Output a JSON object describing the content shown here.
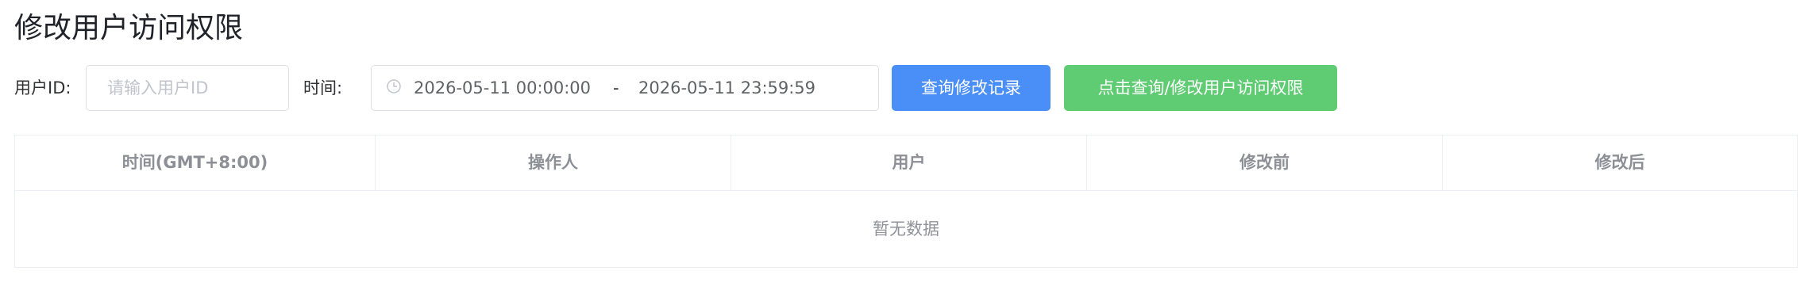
{
  "page_title": "修改用户访问权限",
  "filters": {
    "user_id_label": "用户ID:",
    "user_id_value": "",
    "user_id_placeholder": "请输入用户ID",
    "time_label": "时间:",
    "time_start": "2026-05-11 00:00:00",
    "time_separator": "-",
    "time_end": "2026-05-11 23:59:59"
  },
  "buttons": {
    "query_label": "查询修改记录",
    "modify_label": "点击查询/修改用户访问权限"
  },
  "table": {
    "columns": [
      "时间(GMT+8:00)",
      "操作人",
      "用户",
      "修改前",
      "修改后"
    ],
    "rows": [],
    "empty_text": "暂无数据"
  },
  "colors": {
    "query_button": "#4a8ff7",
    "modify_button": "#5fcc74"
  },
  "icons": {
    "time_range": "clock-icon"
  }
}
